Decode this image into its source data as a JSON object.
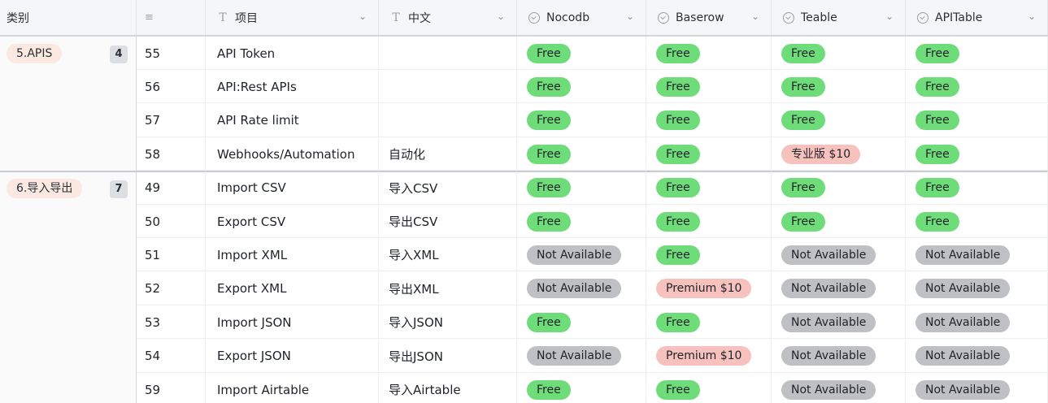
{
  "header": {
    "group_label": "类别",
    "columns": [
      {
        "id": "project",
        "label": "项目",
        "type_icon": "text-type-icon"
      },
      {
        "id": "chinese",
        "label": "中文",
        "type_icon": "text-type-icon"
      },
      {
        "id": "nocodb",
        "label": "Nocodb",
        "type_icon": "single-select-icon"
      },
      {
        "id": "baserow",
        "label": "Baserow",
        "type_icon": "single-select-icon"
      },
      {
        "id": "teable",
        "label": "Teable",
        "type_icon": "single-select-icon"
      },
      {
        "id": "apitable",
        "label": "APITable",
        "type_icon": "single-select-icon"
      }
    ]
  },
  "colors": {
    "Free": "#6fdc7a",
    "Not Available": "#bfc0c3",
    "Premium $10": "#f7c1bd",
    "专业版 $10": "#f7c1bd"
  },
  "groups": [
    {
      "name": "5.APIS",
      "count": "4",
      "rows": [
        {
          "no": "55",
          "project": "API Token",
          "chinese": "",
          "nocodb": "Free",
          "baserow": "Free",
          "teable": "Free",
          "apitable": "Free"
        },
        {
          "no": "56",
          "project": "API:Rest APIs",
          "chinese": "",
          "nocodb": "Free",
          "baserow": "Free",
          "teable": "Free",
          "apitable": "Free"
        },
        {
          "no": "57",
          "project": "API Rate limit",
          "chinese": "",
          "nocodb": "Free",
          "baserow": "Free",
          "teable": "Free",
          "apitable": "Free"
        },
        {
          "no": "58",
          "project": "Webhooks/Automation",
          "chinese": "自动化",
          "nocodb": "Free",
          "baserow": "Free",
          "teable": "专业版 $10",
          "apitable": "Free"
        }
      ]
    },
    {
      "name": "6.导入导出",
      "count": "7",
      "rows": [
        {
          "no": "49",
          "project": "Import CSV",
          "chinese": "导入CSV",
          "nocodb": "Free",
          "baserow": "Free",
          "teable": "Free",
          "apitable": "Free"
        },
        {
          "no": "50",
          "project": "Export CSV",
          "chinese": "导出CSV",
          "nocodb": "Free",
          "baserow": "Free",
          "teable": "Free",
          "apitable": "Free"
        },
        {
          "no": "51",
          "project": "Import XML",
          "chinese": "导入XML",
          "nocodb": "Not Available",
          "baserow": "Free",
          "teable": "Not Available",
          "apitable": "Not Available"
        },
        {
          "no": "52",
          "project": "Export XML",
          "chinese": "导出XML",
          "nocodb": "Not Available",
          "baserow": "Premium $10",
          "teable": "Not Available",
          "apitable": "Not Available"
        },
        {
          "no": "53",
          "project": "Import JSON",
          "chinese": "导入JSON",
          "nocodb": "Free",
          "baserow": "Free",
          "teable": "Not Available",
          "apitable": "Not Available"
        },
        {
          "no": "54",
          "project": "Export JSON",
          "chinese": "导出JSON",
          "nocodb": "Not Available",
          "baserow": "Premium $10",
          "teable": "Not Available",
          "apitable": "Not Available"
        },
        {
          "no": "59",
          "project": "Import Airtable",
          "chinese": "导入Airtable",
          "nocodb": "Free",
          "baserow": "Free",
          "teable": "Not Available",
          "apitable": "Not Available"
        }
      ]
    }
  ]
}
